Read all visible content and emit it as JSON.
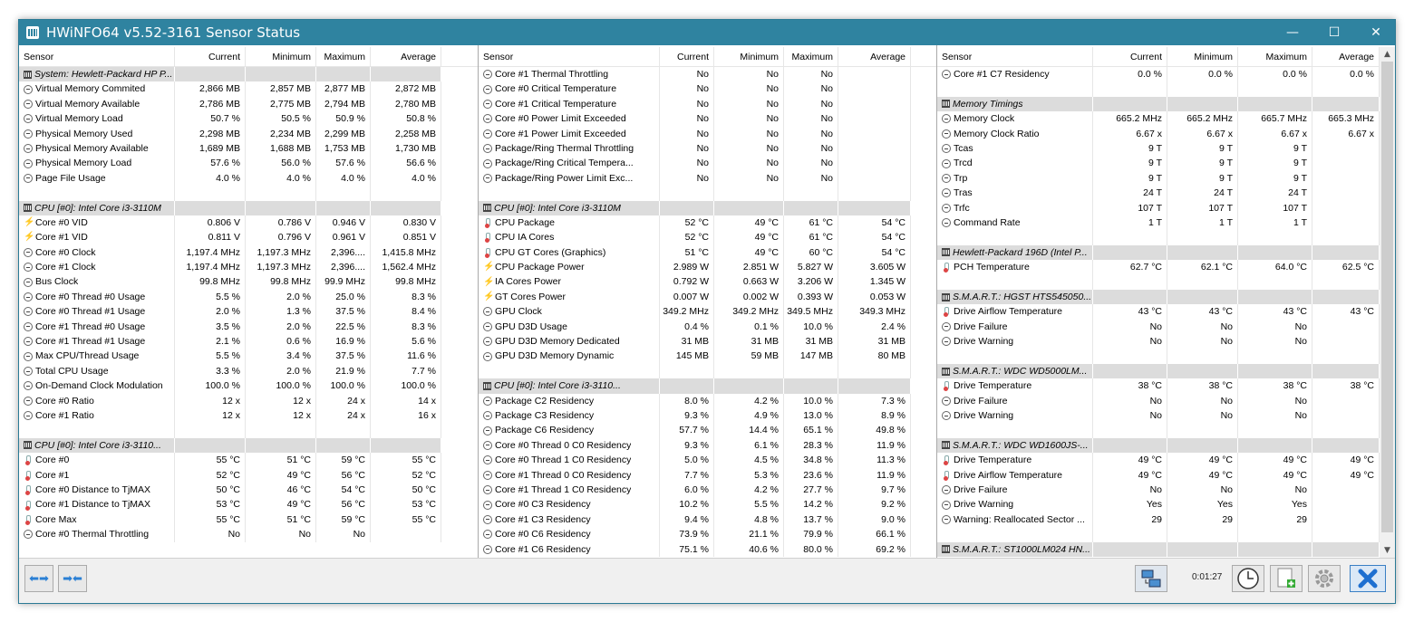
{
  "window": {
    "title": "HWiNFO64 v5.52-3161 Sensor Status",
    "minimize": "—",
    "maximize": "☐",
    "close": "✕"
  },
  "columns": [
    "Sensor",
    "Current",
    "Minimum",
    "Maximum",
    "Average"
  ],
  "panels": [
    {
      "rows": [
        {
          "g": 1,
          "i": "chip",
          "n": "System: Hewlett-Packard HP P..."
        },
        {
          "i": "gauge",
          "n": "Virtual Memory Commited",
          "v": [
            "2,866 MB",
            "2,857 MB",
            "2,877 MB",
            "2,872 MB"
          ]
        },
        {
          "i": "gauge",
          "n": "Virtual Memory Available",
          "v": [
            "2,786 MB",
            "2,775 MB",
            "2,794 MB",
            "2,780 MB"
          ]
        },
        {
          "i": "gauge",
          "n": "Virtual Memory Load",
          "v": [
            "50.7 %",
            "50.5 %",
            "50.9 %",
            "50.8 %"
          ]
        },
        {
          "i": "gauge",
          "n": "Physical Memory Used",
          "v": [
            "2,298 MB",
            "2,234 MB",
            "2,299 MB",
            "2,258 MB"
          ]
        },
        {
          "i": "gauge",
          "n": "Physical Memory Available",
          "v": [
            "1,689 MB",
            "1,688 MB",
            "1,753 MB",
            "1,730 MB"
          ]
        },
        {
          "i": "gauge",
          "n": "Physical Memory Load",
          "v": [
            "57.6 %",
            "56.0 %",
            "57.6 %",
            "56.6 %"
          ]
        },
        {
          "i": "gauge",
          "n": "Page File Usage",
          "v": [
            "4.0 %",
            "4.0 %",
            "4.0 %",
            "4.0 %"
          ]
        },
        {
          "e": 1
        },
        {
          "g": 1,
          "i": "chip",
          "n": "CPU [#0]: Intel Core i3-3110M"
        },
        {
          "i": "volt",
          "n": "Core #0 VID",
          "v": [
            "0.806 V",
            "0.786 V",
            "0.946 V",
            "0.830 V"
          ]
        },
        {
          "i": "volt",
          "n": "Core #1 VID",
          "v": [
            "0.811 V",
            "0.796 V",
            "0.961 V",
            "0.851 V"
          ]
        },
        {
          "i": "gauge",
          "n": "Core #0 Clock",
          "v": [
            "1,197.4 MHz",
            "1,197.3 MHz",
            "2,396....",
            "1,415.8 MHz"
          ]
        },
        {
          "i": "gauge",
          "n": "Core #1 Clock",
          "v": [
            "1,197.4 MHz",
            "1,197.3 MHz",
            "2,396....",
            "1,562.4 MHz"
          ]
        },
        {
          "i": "gauge",
          "n": "Bus Clock",
          "v": [
            "99.8 MHz",
            "99.8 MHz",
            "99.9 MHz",
            "99.8 MHz"
          ]
        },
        {
          "i": "gauge",
          "n": "Core #0 Thread #0 Usage",
          "v": [
            "5.5 %",
            "2.0 %",
            "25.0 %",
            "8.3 %"
          ]
        },
        {
          "i": "gauge",
          "n": "Core #0 Thread #1 Usage",
          "v": [
            "2.0 %",
            "1.3 %",
            "37.5 %",
            "8.4 %"
          ]
        },
        {
          "i": "gauge",
          "n": "Core #1 Thread #0 Usage",
          "v": [
            "3.5 %",
            "2.0 %",
            "22.5 %",
            "8.3 %"
          ]
        },
        {
          "i": "gauge",
          "n": "Core #1 Thread #1 Usage",
          "v": [
            "2.1 %",
            "0.6 %",
            "16.9 %",
            "5.6 %"
          ]
        },
        {
          "i": "gauge",
          "n": "Max CPU/Thread Usage",
          "v": [
            "5.5 %",
            "3.4 %",
            "37.5 %",
            "11.6 %"
          ]
        },
        {
          "i": "gauge",
          "n": "Total CPU Usage",
          "v": [
            "3.3 %",
            "2.0 %",
            "21.9 %",
            "7.7 %"
          ]
        },
        {
          "i": "gauge",
          "n": "On-Demand Clock Modulation",
          "v": [
            "100.0 %",
            "100.0 %",
            "100.0 %",
            "100.0 %"
          ]
        },
        {
          "i": "gauge",
          "n": "Core #0 Ratio",
          "v": [
            "12 x",
            "12 x",
            "24 x",
            "14 x"
          ]
        },
        {
          "i": "gauge",
          "n": "Core #1 Ratio",
          "v": [
            "12 x",
            "12 x",
            "24 x",
            "16 x"
          ]
        },
        {
          "e": 1
        },
        {
          "g": 1,
          "i": "chip",
          "n": "CPU [#0]: Intel Core i3-3110..."
        },
        {
          "i": "temp",
          "n": "Core #0",
          "v": [
            "55 °C",
            "51 °C",
            "59 °C",
            "55 °C"
          ]
        },
        {
          "i": "temp",
          "n": "Core #1",
          "v": [
            "52 °C",
            "49 °C",
            "56 °C",
            "52 °C"
          ]
        },
        {
          "i": "temp",
          "n": "Core #0 Distance to TjMAX",
          "v": [
            "50 °C",
            "46 °C",
            "54 °C",
            "50 °C"
          ]
        },
        {
          "i": "temp",
          "n": "Core #1 Distance to TjMAX",
          "v": [
            "53 °C",
            "49 °C",
            "56 °C",
            "53 °C"
          ]
        },
        {
          "i": "temp",
          "n": "Core Max",
          "v": [
            "55 °C",
            "51 °C",
            "59 °C",
            "55 °C"
          ]
        },
        {
          "i": "gauge",
          "n": "Core #0 Thermal Throttling",
          "v": [
            "No",
            "No",
            "No",
            ""
          ]
        }
      ]
    },
    {
      "rows": [
        {
          "i": "gauge",
          "n": "Core #1 Thermal Throttling",
          "v": [
            "No",
            "No",
            "No",
            ""
          ]
        },
        {
          "i": "gauge",
          "n": "Core #0 Critical Temperature",
          "v": [
            "No",
            "No",
            "No",
            ""
          ]
        },
        {
          "i": "gauge",
          "n": "Core #1 Critical Temperature",
          "v": [
            "No",
            "No",
            "No",
            ""
          ]
        },
        {
          "i": "gauge",
          "n": "Core #0 Power Limit Exceeded",
          "v": [
            "No",
            "No",
            "No",
            ""
          ]
        },
        {
          "i": "gauge",
          "n": "Core #1 Power Limit Exceeded",
          "v": [
            "No",
            "No",
            "No",
            ""
          ]
        },
        {
          "i": "gauge",
          "n": "Package/Ring Thermal Throttling",
          "v": [
            "No",
            "No",
            "No",
            ""
          ]
        },
        {
          "i": "gauge",
          "n": "Package/Ring Critical Tempera...",
          "v": [
            "No",
            "No",
            "No",
            ""
          ]
        },
        {
          "i": "gauge",
          "n": "Package/Ring Power Limit Exc...",
          "v": [
            "No",
            "No",
            "No",
            ""
          ]
        },
        {
          "e": 1
        },
        {
          "g": 1,
          "i": "chip",
          "n": "CPU [#0]: Intel Core i3-3110M"
        },
        {
          "i": "temp",
          "n": "CPU Package",
          "v": [
            "52 °C",
            "49 °C",
            "61 °C",
            "54 °C"
          ]
        },
        {
          "i": "temp",
          "n": "CPU IA Cores",
          "v": [
            "52 °C",
            "49 °C",
            "61 °C",
            "54 °C"
          ]
        },
        {
          "i": "temp",
          "n": "CPU GT Cores (Graphics)",
          "v": [
            "51 °C",
            "49 °C",
            "60 °C",
            "54 °C"
          ]
        },
        {
          "i": "volt",
          "n": "CPU Package Power",
          "v": [
            "2.989 W",
            "2.851 W",
            "5.827 W",
            "3.605 W"
          ]
        },
        {
          "i": "volt",
          "n": "IA Cores Power",
          "v": [
            "0.792 W",
            "0.663 W",
            "3.206 W",
            "1.345 W"
          ]
        },
        {
          "i": "volt",
          "n": "GT Cores Power",
          "v": [
            "0.007 W",
            "0.002 W",
            "0.393 W",
            "0.053 W"
          ]
        },
        {
          "i": "gauge",
          "n": "GPU Clock",
          "v": [
            "349.2 MHz",
            "349.2 MHz",
            "349.5 MHz",
            "349.3 MHz"
          ]
        },
        {
          "i": "gauge",
          "n": "GPU D3D Usage",
          "v": [
            "0.4 %",
            "0.1 %",
            "10.0 %",
            "2.4 %"
          ]
        },
        {
          "i": "gauge",
          "n": "GPU D3D Memory Dedicated",
          "v": [
            "31 MB",
            "31 MB",
            "31 MB",
            "31 MB"
          ]
        },
        {
          "i": "gauge",
          "n": "GPU D3D Memory Dynamic",
          "v": [
            "145 MB",
            "59 MB",
            "147 MB",
            "80 MB"
          ]
        },
        {
          "e": 1
        },
        {
          "g": 1,
          "i": "chip",
          "n": "CPU [#0]: Intel Core i3-3110..."
        },
        {
          "i": "gauge",
          "n": "Package C2 Residency",
          "v": [
            "8.0 %",
            "4.2 %",
            "10.0 %",
            "7.3 %"
          ]
        },
        {
          "i": "gauge",
          "n": "Package C3 Residency",
          "v": [
            "9.3 %",
            "4.9 %",
            "13.0 %",
            "8.9 %"
          ]
        },
        {
          "i": "gauge",
          "n": "Package C6 Residency",
          "v": [
            "57.7 %",
            "14.4 %",
            "65.1 %",
            "49.8 %"
          ]
        },
        {
          "i": "gauge",
          "n": "Core #0 Thread 0 C0 Residency",
          "v": [
            "9.3 %",
            "6.1 %",
            "28.3 %",
            "11.9 %"
          ]
        },
        {
          "i": "gauge",
          "n": "Core #0 Thread 1 C0 Residency",
          "v": [
            "5.0 %",
            "4.5 %",
            "34.8 %",
            "11.3 %"
          ]
        },
        {
          "i": "gauge",
          "n": "Core #1 Thread 0 C0 Residency",
          "v": [
            "7.7 %",
            "5.3 %",
            "23.6 %",
            "11.9 %"
          ]
        },
        {
          "i": "gauge",
          "n": "Core #1 Thread 1 C0 Residency",
          "v": [
            "6.0 %",
            "4.2 %",
            "27.7 %",
            "9.7 %"
          ]
        },
        {
          "i": "gauge",
          "n": "Core #0 C3 Residency",
          "v": [
            "10.2 %",
            "5.5 %",
            "14.2 %",
            "9.2 %"
          ]
        },
        {
          "i": "gauge",
          "n": "Core #1 C3 Residency",
          "v": [
            "9.4 %",
            "4.8 %",
            "13.7 %",
            "9.0 %"
          ]
        },
        {
          "i": "gauge",
          "n": "Core #0 C6 Residency",
          "v": [
            "73.9 %",
            "21.1 %",
            "79.9 %",
            "66.1 %"
          ]
        },
        {
          "i": "gauge",
          "n": "Core #1 C6 Residency",
          "v": [
            "75.1 %",
            "40.6 %",
            "80.0 %",
            "69.2 %"
          ]
        }
      ]
    },
    {
      "rows": [
        {
          "i": "gauge",
          "n": "Core #1 C7 Residency",
          "v": [
            "0.0 %",
            "0.0 %",
            "0.0 %",
            "0.0 %"
          ]
        },
        {
          "e": 1
        },
        {
          "g": 1,
          "i": "chip",
          "n": "Memory Timings"
        },
        {
          "i": "gauge",
          "n": "Memory Clock",
          "v": [
            "665.2 MHz",
            "665.2 MHz",
            "665.7 MHz",
            "665.3 MHz"
          ]
        },
        {
          "i": "gauge",
          "n": "Memory Clock Ratio",
          "v": [
            "6.67 x",
            "6.67 x",
            "6.67 x",
            "6.67 x"
          ]
        },
        {
          "i": "gauge",
          "n": "Tcas",
          "v": [
            "9 T",
            "9 T",
            "9 T",
            ""
          ]
        },
        {
          "i": "gauge",
          "n": "Trcd",
          "v": [
            "9 T",
            "9 T",
            "9 T",
            ""
          ]
        },
        {
          "i": "gauge",
          "n": "Trp",
          "v": [
            "9 T",
            "9 T",
            "9 T",
            ""
          ]
        },
        {
          "i": "gauge",
          "n": "Tras",
          "v": [
            "24 T",
            "24 T",
            "24 T",
            ""
          ]
        },
        {
          "i": "gauge",
          "n": "Trfc",
          "v": [
            "107 T",
            "107 T",
            "107 T",
            ""
          ]
        },
        {
          "i": "gauge",
          "n": "Command Rate",
          "v": [
            "1 T",
            "1 T",
            "1 T",
            ""
          ]
        },
        {
          "e": 1
        },
        {
          "g": 1,
          "i": "chip",
          "n": "Hewlett-Packard 196D (Intel P..."
        },
        {
          "i": "temp",
          "n": "PCH Temperature",
          "v": [
            "62.7 °C",
            "62.1 °C",
            "64.0 °C",
            "62.5 °C"
          ]
        },
        {
          "e": 1
        },
        {
          "g": 1,
          "i": "chip",
          "n": "S.M.A.R.T.: HGST HTS545050..."
        },
        {
          "i": "temp",
          "n": "Drive Airflow Temperature",
          "v": [
            "43 °C",
            "43 °C",
            "43 °C",
            "43 °C"
          ]
        },
        {
          "i": "gauge",
          "n": "Drive Failure",
          "v": [
            "No",
            "No",
            "No",
            ""
          ]
        },
        {
          "i": "gauge",
          "n": "Drive Warning",
          "v": [
            "No",
            "No",
            "No",
            ""
          ]
        },
        {
          "e": 1
        },
        {
          "g": 1,
          "i": "chip",
          "n": "S.M.A.R.T.: WDC WD5000LM..."
        },
        {
          "i": "temp",
          "n": "Drive Temperature",
          "v": [
            "38 °C",
            "38 °C",
            "38 °C",
            "38 °C"
          ]
        },
        {
          "i": "gauge",
          "n": "Drive Failure",
          "v": [
            "No",
            "No",
            "No",
            ""
          ]
        },
        {
          "i": "gauge",
          "n": "Drive Warning",
          "v": [
            "No",
            "No",
            "No",
            ""
          ]
        },
        {
          "e": 1
        },
        {
          "g": 1,
          "i": "chip",
          "n": "S.M.A.R.T.: WDC WD1600JS-..."
        },
        {
          "i": "temp",
          "n": "Drive Temperature",
          "v": [
            "49 °C",
            "49 °C",
            "49 °C",
            "49 °C"
          ]
        },
        {
          "i": "temp",
          "n": "Drive Airflow Temperature",
          "v": [
            "49 °C",
            "49 °C",
            "49 °C",
            "49 °C"
          ]
        },
        {
          "i": "gauge",
          "n": "Drive Failure",
          "v": [
            "No",
            "No",
            "No",
            ""
          ]
        },
        {
          "i": "gauge",
          "n": "Drive Warning",
          "v": [
            "Yes",
            "Yes",
            "Yes",
            ""
          ]
        },
        {
          "i": "gauge",
          "n": "Warning: Reallocated Sector ...",
          "v": [
            "29",
            "29",
            "29",
            ""
          ]
        },
        {
          "e": 1
        },
        {
          "g": 1,
          "i": "chip",
          "n": "S.M.A.R.T.: ST1000LM024 HN..."
        }
      ]
    }
  ],
  "footer": {
    "timer": "0:01:27",
    "expand_icon": "⬅➡",
    "collapse_icon": "➡⬅"
  },
  "colors": {
    "titlebar": "#2f83a0",
    "group_bg": "#dcdcdc",
    "accent": "#2a7fd4"
  }
}
